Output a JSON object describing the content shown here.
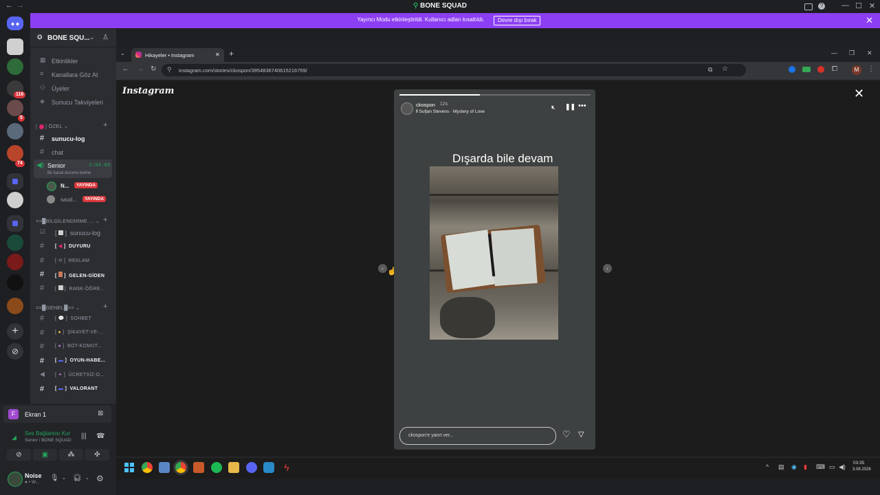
{
  "window": {
    "title": "BONE SQUAD",
    "nav_back": "←",
    "nav_forward": "→",
    "minimize": "—",
    "maximize": "☐",
    "close": "✕"
  },
  "banner": {
    "message": "Yayıncı Modu etkinleştirildi. Kullanıcı adları kısaltıldı.",
    "button": "Devre dışı bırak",
    "close": "✕"
  },
  "server_rail": {
    "badges": [
      "116",
      "5",
      "74"
    ]
  },
  "server": {
    "name": "BONE SQU..."
  },
  "nav_items": [
    {
      "label": "Etkinlikler",
      "icon": "calendar-icon"
    },
    {
      "label": "Kanallara Göz At",
      "icon": "browse-icon"
    },
    {
      "label": "Üyeler",
      "icon": "members-icon"
    },
    {
      "label": "Sunucu Takviyeleri",
      "icon": "boost-icon"
    }
  ],
  "category_private": "ÖZEL",
  "channels_top": [
    {
      "label": "sunucu-log",
      "bold": true
    },
    {
      "label": "chat",
      "bold": false
    }
  ],
  "voice": {
    "name": "Senior",
    "timer": "2:04:03",
    "status": "Bir kanal durumu belirle"
  },
  "voice_users": [
    {
      "name": "N...",
      "live": "YAYINDA"
    },
    {
      "name": "saud...",
      "live": "YAYINDA"
    }
  ],
  "category_info": "BİLGİLENDİRME ...",
  "info_channels": [
    {
      "label": "sunucu-log",
      "bold": false
    },
    {
      "label": "REKLAM",
      "bold": false
    },
    {
      "label": "DUYURU",
      "bold": true
    },
    {
      "label": "GELEN-GİDEN",
      "bold": true
    },
    {
      "label": "RANK-ÖĞRE...",
      "bold": false
    }
  ],
  "category_general": "GENEL",
  "general_channels": [
    {
      "label": "SOHBET",
      "bold": false
    },
    {
      "label": "ŞİKAYET-VE-...",
      "bold": false
    },
    {
      "label": "BOT-KOMUT...",
      "bold": false
    },
    {
      "label": "OYUN-HABE...",
      "bold": true
    },
    {
      "label": "ÜCRETSİZ-O...",
      "bold": false
    },
    {
      "label": "VALORANT",
      "bold": true
    }
  ],
  "screen_share": {
    "avatar": "F",
    "label": "Ekran 1"
  },
  "voice_connection": {
    "title": "Ses Bağlantısı Kur",
    "subtitle": "Senior / BONE SQUAD"
  },
  "user": {
    "name": "Noise",
    "status": "● • W..."
  },
  "browser": {
    "tab_title": "Hikayeler • Instagram",
    "tab_close": "✕",
    "new_tab": "+",
    "url": "instagram.com/stories/ckospon/3954836740615216759/",
    "profile_letter": "M"
  },
  "instagram": {
    "logo": "Instagram",
    "close": "✕",
    "username": "ckospon",
    "time": "12s",
    "music": "Sufjan Stevens · Mystery of Love",
    "caption": "Dışarda bile devam",
    "reply_placeholder": "ckospon'e yanıt ver..."
  },
  "taskbar": {
    "time": "03:35",
    "date": "3.08.2026"
  },
  "colors": {
    "banner": "#8c3ff2",
    "live": "#da373c",
    "voice_green": "#23a55a",
    "rail": "#1e1f22",
    "sidebar": "#2b2d31"
  }
}
